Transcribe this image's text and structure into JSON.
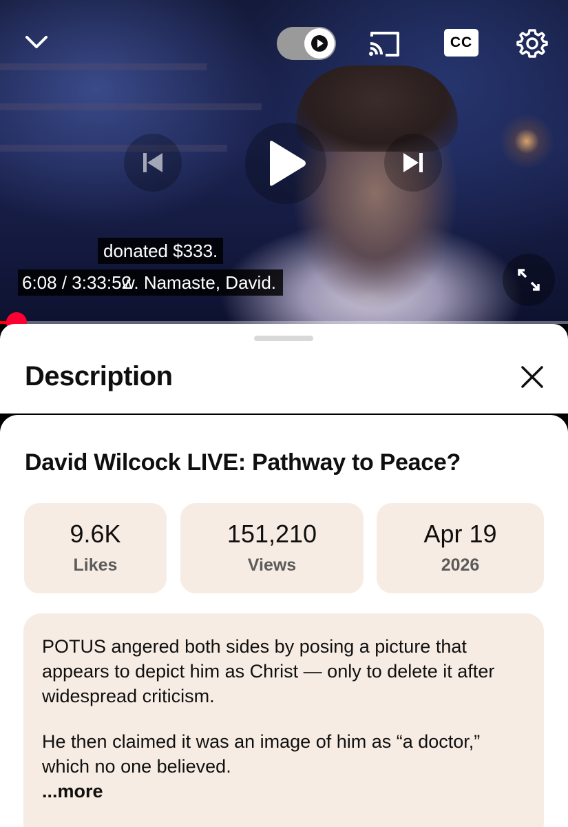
{
  "player": {
    "current_time": "6:08",
    "duration": "3:33:52",
    "time_display": "6:08 / 3:33:52",
    "progress_fraction": 0.029,
    "overlay_line_1": "donated $333.",
    "overlay_line_2": "w. Namaste, David.",
    "controls": {
      "collapse": "chevron-down-icon",
      "autoplay": "autoplay-toggle",
      "cast": "cast-icon",
      "captions_label": "CC",
      "settings": "gear-icon",
      "previous": "previous-icon",
      "play": "play-icon",
      "next": "next-icon",
      "fullscreen": "fullscreen-icon"
    },
    "accent_color": "#ff0033"
  },
  "panel": {
    "title": "Description",
    "close": "close-icon"
  },
  "video": {
    "title": "David Wilcock LIVE: Pathway to Peace?",
    "stats": [
      {
        "value": "9.6K",
        "label": "Likes"
      },
      {
        "value": "151,210",
        "label": "Views"
      },
      {
        "value": "Apr 19",
        "label": "2026"
      }
    ],
    "description_paragraphs": [
      "POTUS angered both sides by posing a picture that appears to depict him as Christ — only to delete it after widespread criticism.",
      "He then claimed it was an image of him as “a doctor,” which no one believed."
    ],
    "more_label": "...more"
  },
  "colors": {
    "card_background": "#f7ece3",
    "stat_label": "#5b5b5b"
  }
}
